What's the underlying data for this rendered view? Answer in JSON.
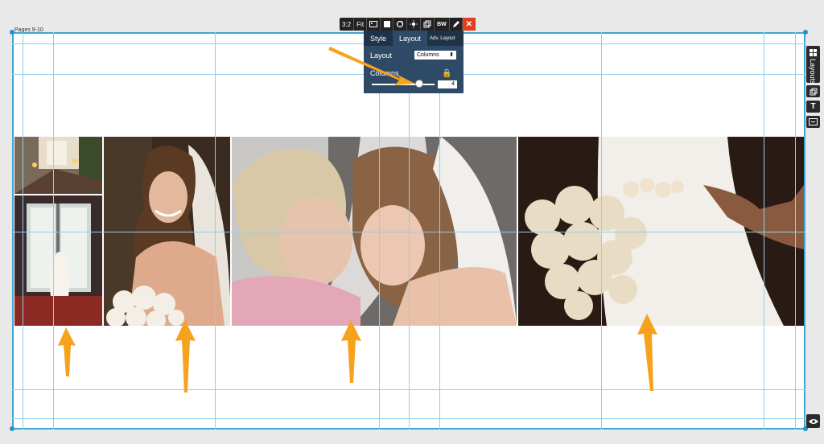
{
  "spread": {
    "pages_label": "Pages 9-10"
  },
  "toolbar": {
    "buttons": [
      {
        "label": "3:2",
        "icon": "aspect-ratio"
      },
      {
        "label": "Fit",
        "icon": "fit"
      },
      {
        "label": "",
        "icon": "photo-swap-icon"
      },
      {
        "label": "",
        "icon": "square-icon"
      },
      {
        "label": "",
        "icon": "rotate-icon"
      },
      {
        "label": "",
        "icon": "brightness-icon"
      },
      {
        "label": "",
        "icon": "duplicate-icon"
      },
      {
        "label": "BW",
        "icon": "bw"
      },
      {
        "label": "",
        "icon": "pencil-icon"
      },
      {
        "label": "✕",
        "icon": "close-icon"
      }
    ]
  },
  "panel": {
    "tabs": [
      "Style",
      "Layout",
      "Adv. Layout"
    ],
    "active_tab": "Layout",
    "layout_label": "Layout",
    "layout_value": "Columns",
    "columns_label": "Columns",
    "columns_value": "4",
    "slider_fraction": 0.75
  },
  "sidebar": {
    "layouts_label": "Layouts",
    "buttons": [
      "duplicate-icon",
      "text-icon",
      "resize-icon"
    ],
    "eye": "eye-icon"
  },
  "colors": {
    "guide": "#8fd0ea",
    "border": "#3fa6d6",
    "accent_arrow": "#f7a21c",
    "close": "#e0401e",
    "panel_bg": "#2f4a66"
  }
}
